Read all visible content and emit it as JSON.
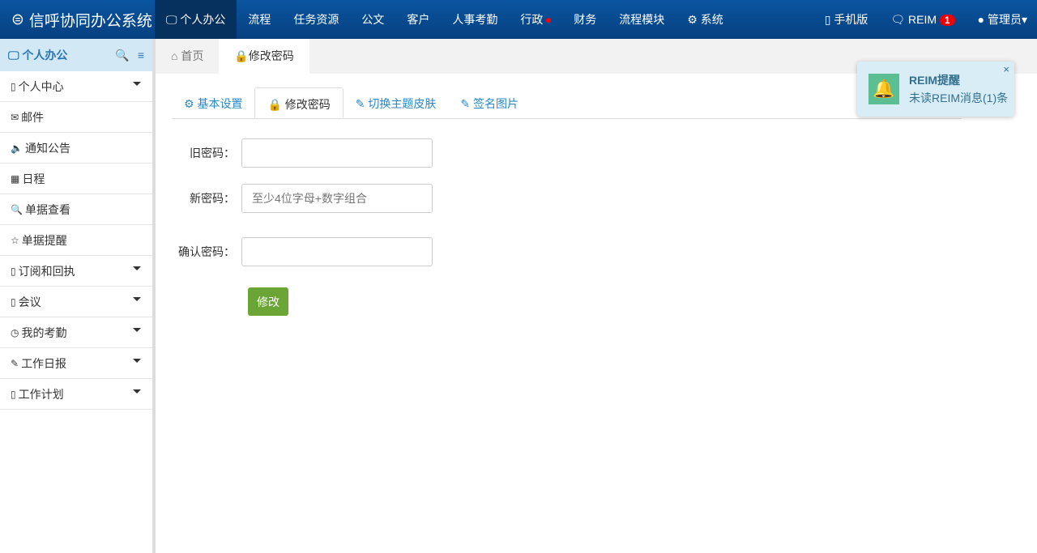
{
  "app": {
    "title": "信呼协同办公系统"
  },
  "nav": [
    "个人办公",
    "流程",
    "任务资源",
    "公文",
    "客户",
    "人事考勤",
    "行政",
    "财务",
    "流程模块",
    "系统"
  ],
  "right": {
    "mobile": "手机版",
    "reim": "REIM",
    "reim_count": "1",
    "user": "管理员"
  },
  "sidebar": {
    "title": "个人办公",
    "items": [
      {
        "icon": "▯",
        "label": "个人中心",
        "caret": true
      },
      {
        "icon": "✉",
        "label": "邮件"
      },
      {
        "icon": "🔈",
        "label": "通知公告"
      },
      {
        "icon": "▦",
        "label": "日程"
      },
      {
        "icon": "🔍",
        "label": "单据查看"
      },
      {
        "icon": "☆",
        "label": "单据提醒"
      },
      {
        "icon": "▯",
        "label": "订阅和回执",
        "caret": true
      },
      {
        "icon": "▯",
        "label": "会议",
        "caret": true
      },
      {
        "icon": "◷",
        "label": "我的考勤",
        "caret": true
      },
      {
        "icon": "✎",
        "label": "工作日报",
        "caret": true
      },
      {
        "icon": "▯",
        "label": "工作计划",
        "caret": true
      }
    ]
  },
  "tabs": {
    "home": "首页",
    "current": "修改密码"
  },
  "inner_tabs": [
    "基本设置",
    "修改密码",
    "切换主题皮肤",
    "签名图片"
  ],
  "form": {
    "old_label": "旧密码：",
    "new_label": "新密码：",
    "new_placeholder": "至少4位字母+数字组合",
    "confirm_label": "确认密码：",
    "submit": "修改"
  },
  "toast": {
    "title": "REIM提醒",
    "message": "未读REIM消息(1)条",
    "close": "×"
  }
}
